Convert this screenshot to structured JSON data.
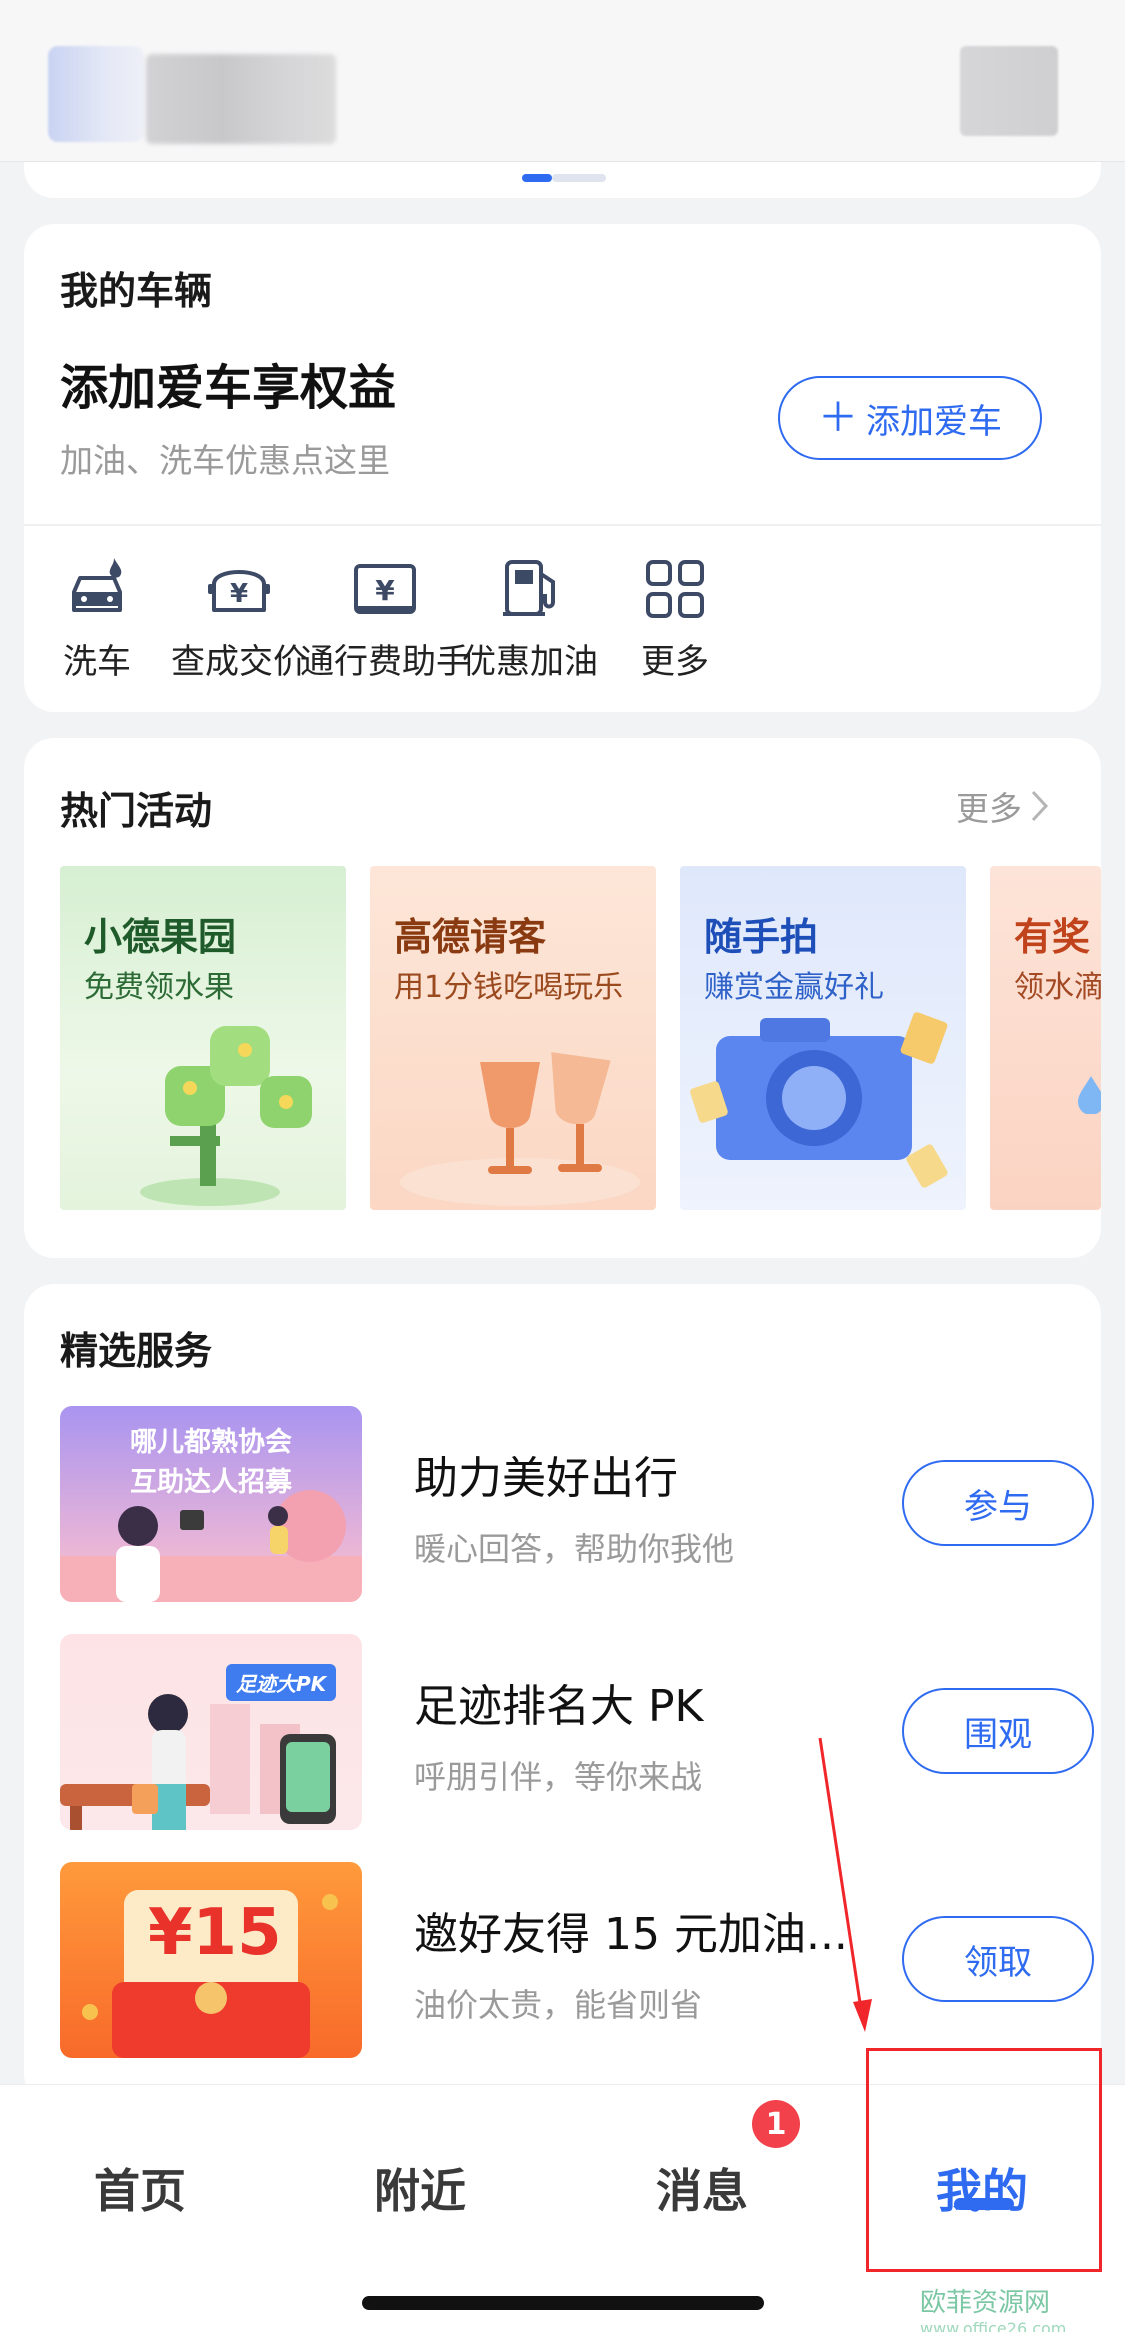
{
  "vehicle": {
    "title": "我的车辆",
    "headline": "添加爱车享权益",
    "subtitle": "加油、洗车优惠点这里",
    "add_button": "添加爱车",
    "quick_actions": [
      {
        "label": "洗车",
        "icon": "car-wash-icon"
      },
      {
        "label": "查成交价",
        "icon": "car-price-icon"
      },
      {
        "label": "通行费助手",
        "icon": "toll-icon"
      },
      {
        "label": "优惠加油",
        "icon": "fuel-pump-icon"
      },
      {
        "label": "更多",
        "icon": "grid-icon"
      }
    ]
  },
  "hot": {
    "title": "热门活动",
    "more": "更多",
    "items": [
      {
        "title": "小德果园",
        "subtitle": "免费领水果"
      },
      {
        "title": "高德请客",
        "subtitle": "用1分钱吃喝玩乐"
      },
      {
        "title": "随手拍",
        "subtitle": "赚赏金赢好礼"
      },
      {
        "title": "有奖",
        "subtitle": "领水滴"
      }
    ]
  },
  "services": {
    "title": "精选服务",
    "items": [
      {
        "name": "助力美好出行",
        "desc": "暖心回答，帮助你我他",
        "button": "参与",
        "thumb_text_1": "哪儿都熟协会",
        "thumb_text_2": "互助达人招募"
      },
      {
        "name": "足迹排名大 PK",
        "desc": "呼朋引伴，等你来战",
        "button": "围观",
        "thumb_text_1": "足迹大PK"
      },
      {
        "name": "邀好友得 15 元加油...",
        "desc": "油价太贵，能省则省",
        "button": "领取",
        "thumb_text_1": "¥15"
      }
    ]
  },
  "tabbar": {
    "tabs": [
      {
        "label": "首页"
      },
      {
        "label": "附近"
      },
      {
        "label": "消息"
      },
      {
        "label": "我的"
      }
    ],
    "badge": "1",
    "active_tab": "我的"
  },
  "watermark": {
    "text": "欧菲资源网",
    "url": "www.office26.com"
  },
  "colors": {
    "accent": "#2f6bf0",
    "badge": "#f2414a",
    "annotation": "#f0262b"
  }
}
